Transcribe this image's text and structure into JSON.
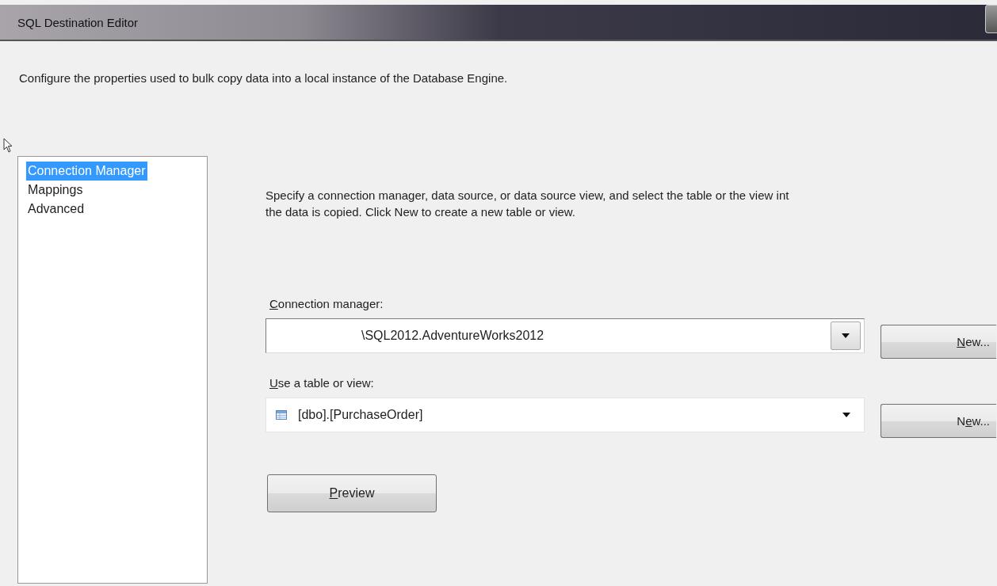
{
  "window": {
    "title": "SQL Destination Editor"
  },
  "description": "Configure the properties used to bulk copy data into a local instance of the Database Engine.",
  "sidebar": {
    "items": [
      {
        "label": "Connection Manager",
        "selected": true
      },
      {
        "label": "Mappings",
        "selected": false
      },
      {
        "label": "Advanced",
        "selected": false
      }
    ]
  },
  "panel": {
    "instructions": "Specify a connection manager, data source, or data source view, and select the table or the view int\nthe data is copied. Click New to create a new table or view.",
    "fields": [
      {
        "label": {
          "key": "C",
          "post": "onnection manager:"
        },
        "value": "\\SQL2012.AdventureWorks2012",
        "kind": "boxed",
        "button": {
          "key": "N",
          "post": "ew..."
        }
      },
      {
        "label": {
          "key": "U",
          "post": "se a table or view:"
        },
        "value": "[dbo].[PurchaseOrder]",
        "kind": "table",
        "button": {
          "pre": "N",
          "key": "e",
          "post": "w..."
        }
      }
    ],
    "preview_button": {
      "key": "P",
      "post": "review"
    }
  }
}
